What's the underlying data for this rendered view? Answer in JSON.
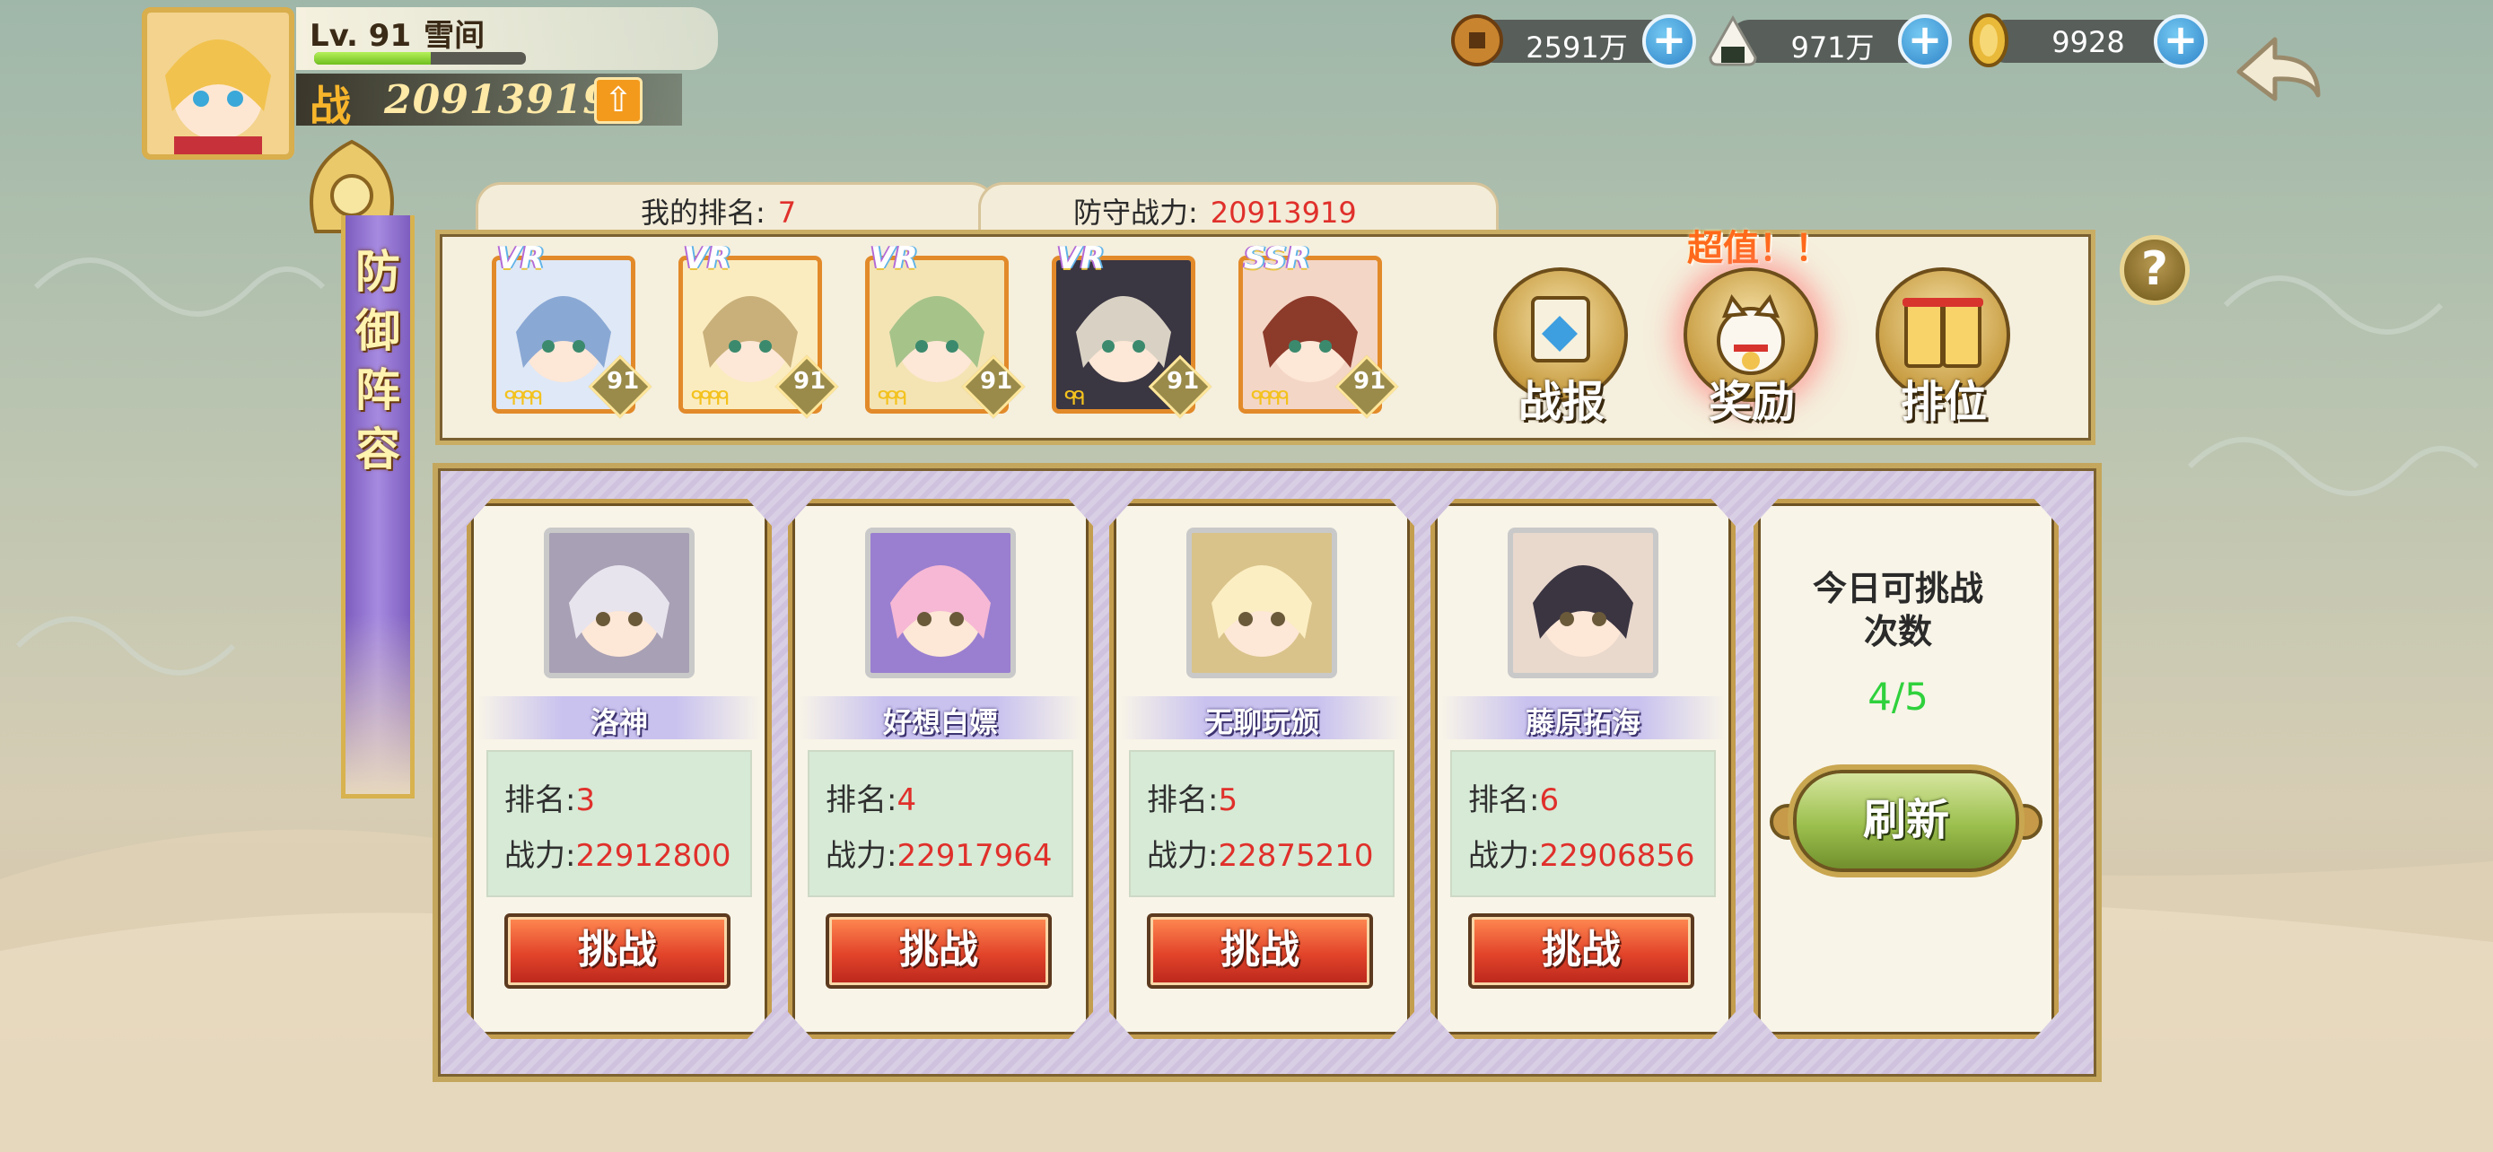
{
  "player": {
    "level": "Lv. 91",
    "name": "雪间",
    "exp_fraction": 0.55,
    "power_badge": "战",
    "power": "20913919"
  },
  "currencies": [
    {
      "icon": "coin-icon",
      "value": "2591万"
    },
    {
      "icon": "rice-ball-icon",
      "value": "971万"
    },
    {
      "icon": "gold-bar-icon",
      "value": "9928"
    }
  ],
  "currency_plus": "+",
  "banner": {
    "title": [
      "防",
      "御",
      "阵",
      "容"
    ]
  },
  "ranking": {
    "my_rank_label": "我的排名:",
    "my_rank": "7",
    "defense_power_label": "防守战力:",
    "defense_power": "20913919"
  },
  "lineup": [
    {
      "rarity": "VR",
      "level": "91",
      "stars": "ᑫᑫᑫᑫ",
      "colors": [
        "#dfe8f6",
        "#8aa8d4"
      ]
    },
    {
      "rarity": "VR",
      "level": "91",
      "stars": "ᑫᑫᑫᑫ",
      "colors": [
        "#fbecc0",
        "#c9b07a"
      ]
    },
    {
      "rarity": "VR",
      "level": "91",
      "stars": "ᑫᑫᑫ",
      "colors": [
        "#f4e4b4",
        "#a6c38a"
      ]
    },
    {
      "rarity": "VR",
      "level": "91",
      "stars": "ᑫᑫ",
      "colors": [
        "#3a3642",
        "#d9d2c4"
      ]
    },
    {
      "rarity": "SSR",
      "level": "91",
      "stars": "ᑫᑫᑫᑫ",
      "colors": [
        "#f4d6c6",
        "#8c3a2a"
      ]
    }
  ],
  "menu": {
    "battle_report": "战报",
    "reward": "奖励",
    "ranking": "排位",
    "super_value": "超值！！",
    "help": "?"
  },
  "opponents": [
    {
      "name": "洛神",
      "rank_label": "排名:",
      "rank": "3",
      "power_label": "战力:",
      "power": "22912800",
      "button": "挑战",
      "colors": [
        "#e8e4ee",
        "#a8a0b4"
      ]
    },
    {
      "name": "好想白嫖",
      "rank_label": "排名:",
      "rank": "4",
      "power_label": "战力:",
      "power": "22917964",
      "button": "挑战",
      "colors": [
        "#f6b8d4",
        "#9a7fd0"
      ]
    },
    {
      "name": "无聊玩颁",
      "rank_label": "排名:",
      "rank": "5",
      "power_label": "战力:",
      "power": "22875210",
      "button": "挑战",
      "colors": [
        "#fbeec2",
        "#d9c38a"
      ]
    },
    {
      "name": "藤原拓海",
      "rank_label": "排名:",
      "rank": "6",
      "power_label": "战力:",
      "power": "22906856",
      "button": "挑战",
      "colors": [
        "#3b3542",
        "#e9d8cc"
      ]
    }
  ],
  "challenges": {
    "title_line1": "今日可挑战",
    "title_line2": "次数",
    "count": "4/5",
    "refresh": "刷新"
  }
}
